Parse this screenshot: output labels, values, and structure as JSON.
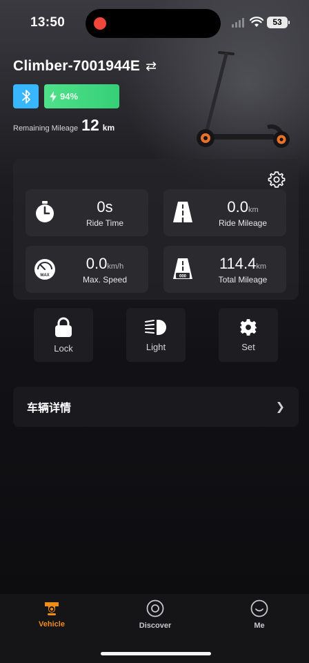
{
  "status_bar": {
    "time": "13:50",
    "battery": "53"
  },
  "device": {
    "name": "Climber-7001944E",
    "battery_percent": "94%",
    "remaining_mileage_label": "Remaining Mileage",
    "remaining_mileage_value": "12",
    "remaining_mileage_unit": "km"
  },
  "stats": {
    "ride_time": {
      "value": "0s",
      "unit": "",
      "label": "Ride Time"
    },
    "ride_mileage": {
      "value": "0.0",
      "unit": "km",
      "label": "Ride Mileage"
    },
    "max_speed": {
      "value": "0.0",
      "unit": "km/h",
      "label": "Max. Speed",
      "gauge_text": "MAX"
    },
    "total_mileage": {
      "value": "114.4",
      "unit": "km",
      "label": "Total Mileage",
      "odo_text": "000"
    }
  },
  "actions": {
    "lock": "Lock",
    "light": "Light",
    "set": "Set"
  },
  "details": {
    "label": "车辆详情"
  },
  "tabs": {
    "vehicle": "Vehicle",
    "discover": "Discover",
    "me": "Me"
  },
  "colors": {
    "accent": "#f08c1a",
    "bluetooth": "#38b7ff",
    "battery": "#4fe08a",
    "record": "#f0463c"
  }
}
